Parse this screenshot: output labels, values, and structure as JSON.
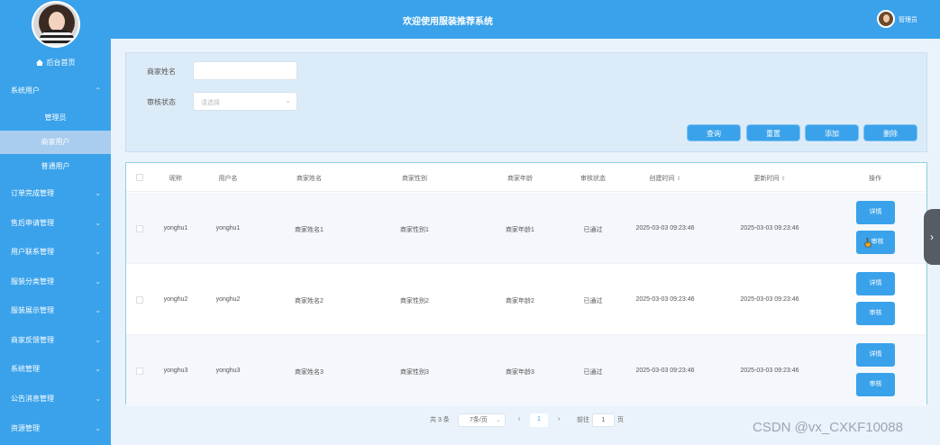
{
  "sidebar": {
    "home": "后台首页",
    "items": [
      {
        "label": "系统用户",
        "chevron": "⌃"
      },
      {
        "label": "订单完成管理",
        "chevron": "⌄"
      },
      {
        "label": "售后申请管理",
        "chevron": "⌄"
      },
      {
        "label": "用户联系管理",
        "chevron": "⌄"
      },
      {
        "label": "服装分类管理",
        "chevron": "⌄"
      },
      {
        "label": "服装展示管理",
        "chevron": "⌄"
      },
      {
        "label": "商家反馈管理",
        "chevron": "⌄"
      },
      {
        "label": "系统管理",
        "chevron": "⌄"
      },
      {
        "label": "公告消息管理",
        "chevron": "⌄"
      },
      {
        "label": "资源管理",
        "chevron": "⌄"
      }
    ],
    "sub_items": [
      "管理员",
      "商家用户",
      "普通用户"
    ]
  },
  "header": {
    "title": "欢迎使用服装推荐系统",
    "user": "管理员"
  },
  "search": {
    "name_label": "商家姓名",
    "name_value": "",
    "status_label": "审核状态",
    "status_placeholder": "请选择"
  },
  "buttons": {
    "query": "查询",
    "reset": "重置",
    "add": "添加",
    "delete": "删除"
  },
  "table": {
    "headers": [
      "昵称",
      "用户名",
      "商家姓名",
      "商家性别",
      "商家年龄",
      "审核状态",
      "创建时间",
      "更新时间",
      "操作"
    ],
    "sort_icon": "⇕",
    "rows": [
      {
        "nickname": "yonghu1",
        "username": "yonghu1",
        "name": "商家姓名1",
        "gender": "商家性别1",
        "age": "商家年龄1",
        "status": "已通过",
        "created": "2025-03-03 09:23:46",
        "updated": "2025-03-03 09:23:46"
      },
      {
        "nickname": "yonghu2",
        "username": "yonghu2",
        "name": "商家姓名2",
        "gender": "商家性别2",
        "age": "商家年龄2",
        "status": "已通过",
        "created": "2025-03-03 09:23:46",
        "updated": "2025-03-03 09:23:46"
      },
      {
        "nickname": "yonghu3",
        "username": "yonghu3",
        "name": "商家姓名3",
        "gender": "商家性别3",
        "age": "商家年龄3",
        "status": "已通过",
        "created": "2025-03-03 09:23:46",
        "updated": "2025-03-03 09:23:46"
      }
    ],
    "detail_label": "详情",
    "review_label": "审核"
  },
  "pagination": {
    "total": "共 3 条",
    "page_size": "7条/页",
    "prev": "‹",
    "current": "1",
    "next": "›",
    "goto_label": "前往",
    "goto_value": "1",
    "page_suffix": "页"
  },
  "watermark": "CSDN @vx_CXKF10088",
  "colors": {
    "primary": "#3aa2ea",
    "panel": "#dcebf8",
    "background": "#eaf3fb"
  }
}
